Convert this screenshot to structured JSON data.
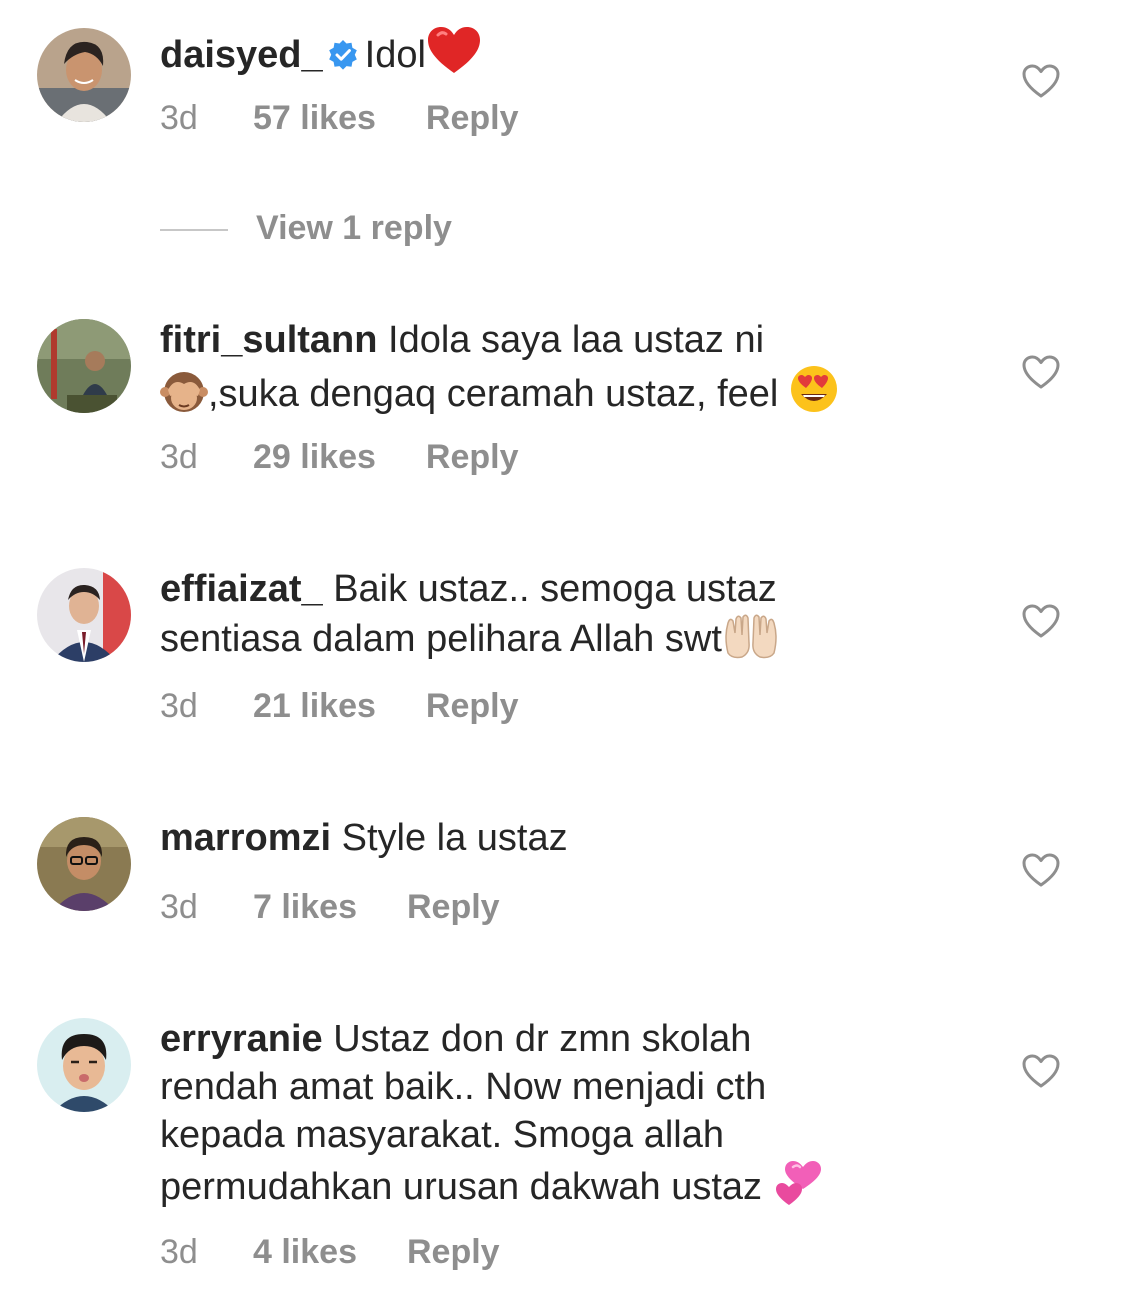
{
  "comments": [
    {
      "username": "daisyed_",
      "verified": true,
      "text": "Idol",
      "trailing_emoji": "red-heart",
      "age": "3d",
      "likes": "57 likes",
      "reply": "Reply",
      "view_replies": "View 1 reply"
    },
    {
      "username": "fitri_sultann",
      "verified": false,
      "text_1": "Idola saya laa ustaz ni",
      "text_2": ",suka dengaq ceramah ustaz, feel",
      "leading_emoji": "see-no-evil-monkey",
      "trailing_emoji": "smiling-face-with-heart-eyes",
      "age": "3d",
      "likes": "29 likes",
      "reply": "Reply"
    },
    {
      "username": "effiaizat_",
      "verified": false,
      "text_1": "Baik ustaz.. semoga ustaz",
      "text_2": "sentiasa dalam pelihara Allah swt",
      "trailing_emoji": "palms-up-together",
      "age": "3d",
      "likes": "21 likes",
      "reply": "Reply"
    },
    {
      "username": "marromzi",
      "verified": false,
      "text": "Style la ustaz",
      "age": "3d",
      "likes": "7 likes",
      "reply": "Reply"
    },
    {
      "username": "erryranie",
      "verified": false,
      "text_1": "Ustaz don dr zmn skolah",
      "text_2": "rendah amat baik.. Now menjadi cth",
      "text_3": "kepada masyarakat. Smoga allah",
      "text_4": "permudahkan urusan dakwah ustaz",
      "trailing_emoji": "revolving-hearts",
      "age": "3d",
      "likes": "4 likes",
      "reply": "Reply"
    }
  ],
  "colors": {
    "text": "#262626",
    "secondary": "#8e8e8e",
    "verified": "#3897f0",
    "divider": "#c7c7c7"
  },
  "icons": {
    "like": "heart-outline-icon",
    "verified": "verified-badge-icon"
  }
}
